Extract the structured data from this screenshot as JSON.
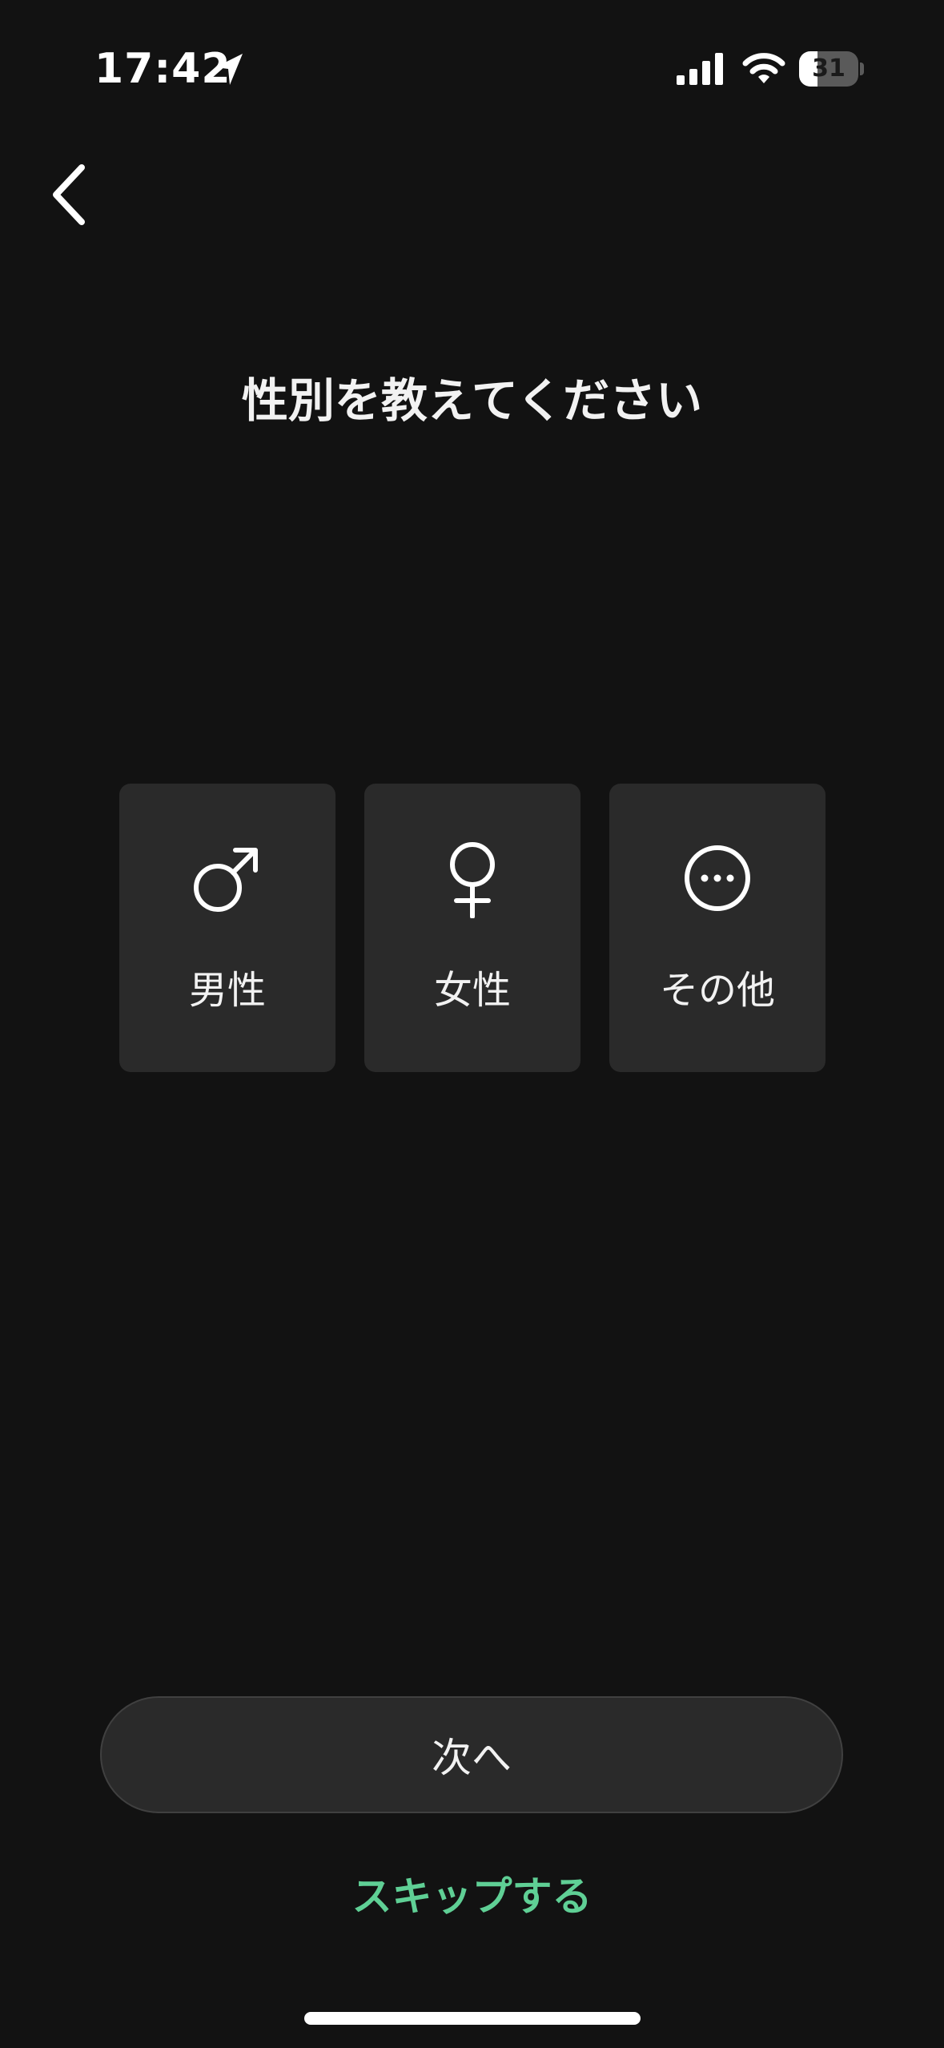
{
  "status_bar": {
    "time": "17:42",
    "battery": "31",
    "battery_level": 0.31,
    "location_icon": "location-arrow-icon",
    "signal_icon": "cellular-signal-icon",
    "wifi_icon": "wifi-icon"
  },
  "nav": {
    "back_icon": "chevron-left-icon"
  },
  "page": {
    "title": "性別を教えてください"
  },
  "options": [
    {
      "id": "male",
      "label": "男性",
      "icon": "male-symbol-icon"
    },
    {
      "id": "female",
      "label": "女性",
      "icon": "female-symbol-icon"
    },
    {
      "id": "other",
      "label": "その他",
      "icon": "more-horizontal-circle-icon"
    }
  ],
  "actions": {
    "next_label": "次へ",
    "skip_label": "スキップする"
  },
  "colors": {
    "background": "#121212",
    "card": "#2a2a2a",
    "accent": "#5fcf95"
  }
}
